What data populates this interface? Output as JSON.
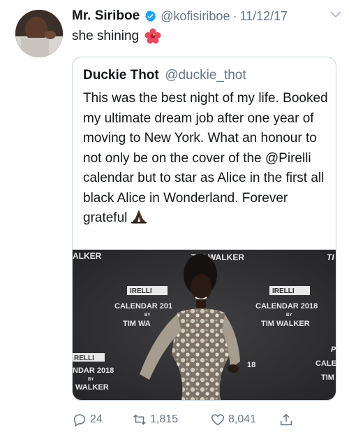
{
  "tweet": {
    "author_name": "Mr. Siriboe",
    "handle": "@kofisiriboe",
    "separator": "·",
    "date": "11/12/17",
    "text": "she shining",
    "emoji": "hibiscus-icon"
  },
  "quote": {
    "author_name": "Duckie Thot",
    "handle": "@duckie_thot",
    "text": "This was the best night of my life. Booked my ultimate dream job after one year of moving to New York. What an honour to not only be on the cover of the @Pirelli calendar but to star as Alice in the first all black Alice in Wonderland. Forever grateful",
    "emoji": "folded-hands-icon",
    "photo": {
      "backdrop_texts": {
        "tl": "ALKER",
        "tc": "TIM WALKER",
        "tr": "TI",
        "brand_left": "IRELLI",
        "cal_left": "CALENDAR 201",
        "by_left": "BY",
        "tim_left": "TIM WA",
        "brand_right": "IRELLI",
        "cal_right": "CALENDAR 2018",
        "by_right": "BY",
        "tim_right": "TIM WALKER",
        "brand_bl": "RELLI",
        "cal_bl": "NDAR 2018",
        "by_bl": "BY",
        "walker_bl": "WALKER",
        "num_mid": "18",
        "brand_br": "P",
        "cal_br": "CALE",
        "tim_br": "TIM"
      }
    }
  },
  "actions": {
    "reply_count": "24",
    "retweet_count": "1,815",
    "like_count": "8,041"
  },
  "colors": {
    "text": "#14171a",
    "muted": "#657786",
    "verified": "#1da1f2",
    "border": "#ccd6dd"
  }
}
